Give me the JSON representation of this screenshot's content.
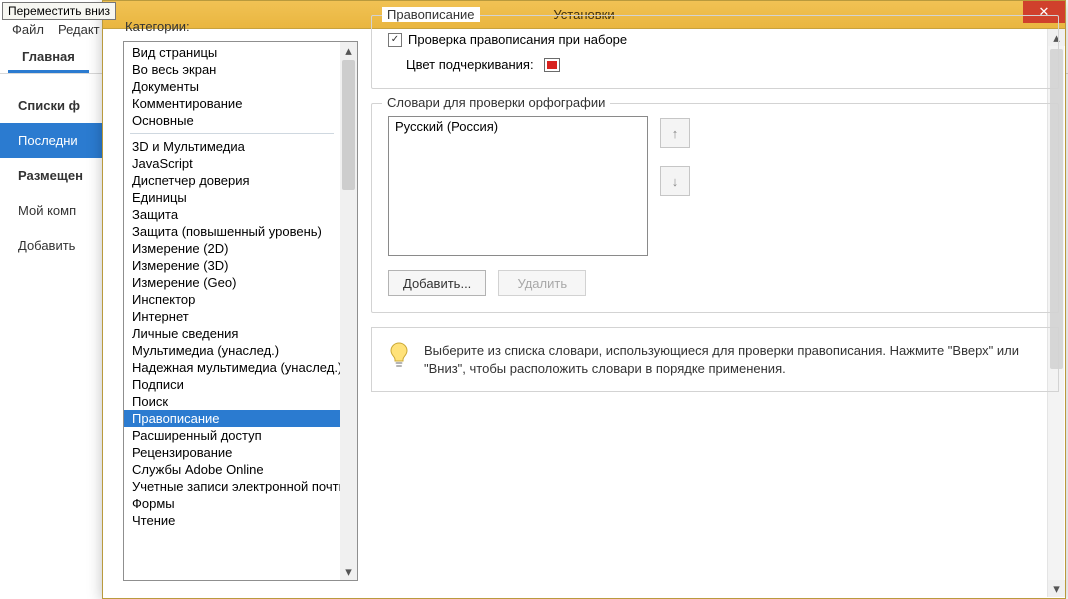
{
  "tooltip": "Переместить вниз",
  "menubar": {
    "file": "Файл",
    "edit": "Редакт"
  },
  "tabs": {
    "home": "Главная"
  },
  "leftnav": {
    "items": [
      {
        "label": "Списки ф",
        "head": true
      },
      {
        "label": "Последни",
        "selected": true
      },
      {
        "label": "Размещен",
        "head": true
      },
      {
        "label": "Мой комп"
      },
      {
        "label": "Добавить"
      }
    ]
  },
  "dialog": {
    "title": "Установки",
    "categories_label": "Категории:",
    "categories_group1": [
      "Вид страницы",
      "Во весь экран",
      "Документы",
      "Комментирование",
      "Основные"
    ],
    "categories_group2": [
      "3D и Мультимедиа",
      "JavaScript",
      "Диспетчер доверия",
      "Единицы",
      "Защита",
      "Защита (повышенный уровень)",
      "Измерение (2D)",
      "Измерение (3D)",
      "Измерение (Geo)",
      "Инспектор",
      "Интернет",
      "Личные сведения",
      "Мультимедиа (унаслед.)",
      "Надежная мультимедиа (унаслед.)",
      "Подписи",
      "Поиск",
      "Правописание",
      "Расширенный доступ",
      "Рецензирование",
      "Службы Adobe Online",
      "Учетные записи электронной почты",
      "Формы",
      "Чтение"
    ],
    "category_selected": "Правописание",
    "spelling": {
      "legend": "Правописание",
      "check_label": "Проверка правописания при наборе",
      "checked": true,
      "underline_label": "Цвет подчеркивания:",
      "underline_color": "#d8221f"
    },
    "dicts": {
      "legend": "Словари для проверки орфографии",
      "items": [
        "Русский (Россия)"
      ],
      "add": "Добавить...",
      "del": "Удалить"
    },
    "hint": "Выберите из списка словари, использующиеся для проверки правописания. Нажмите \"Вверх\" или \"Вниз\", чтобы расположить словари в порядке применения."
  }
}
